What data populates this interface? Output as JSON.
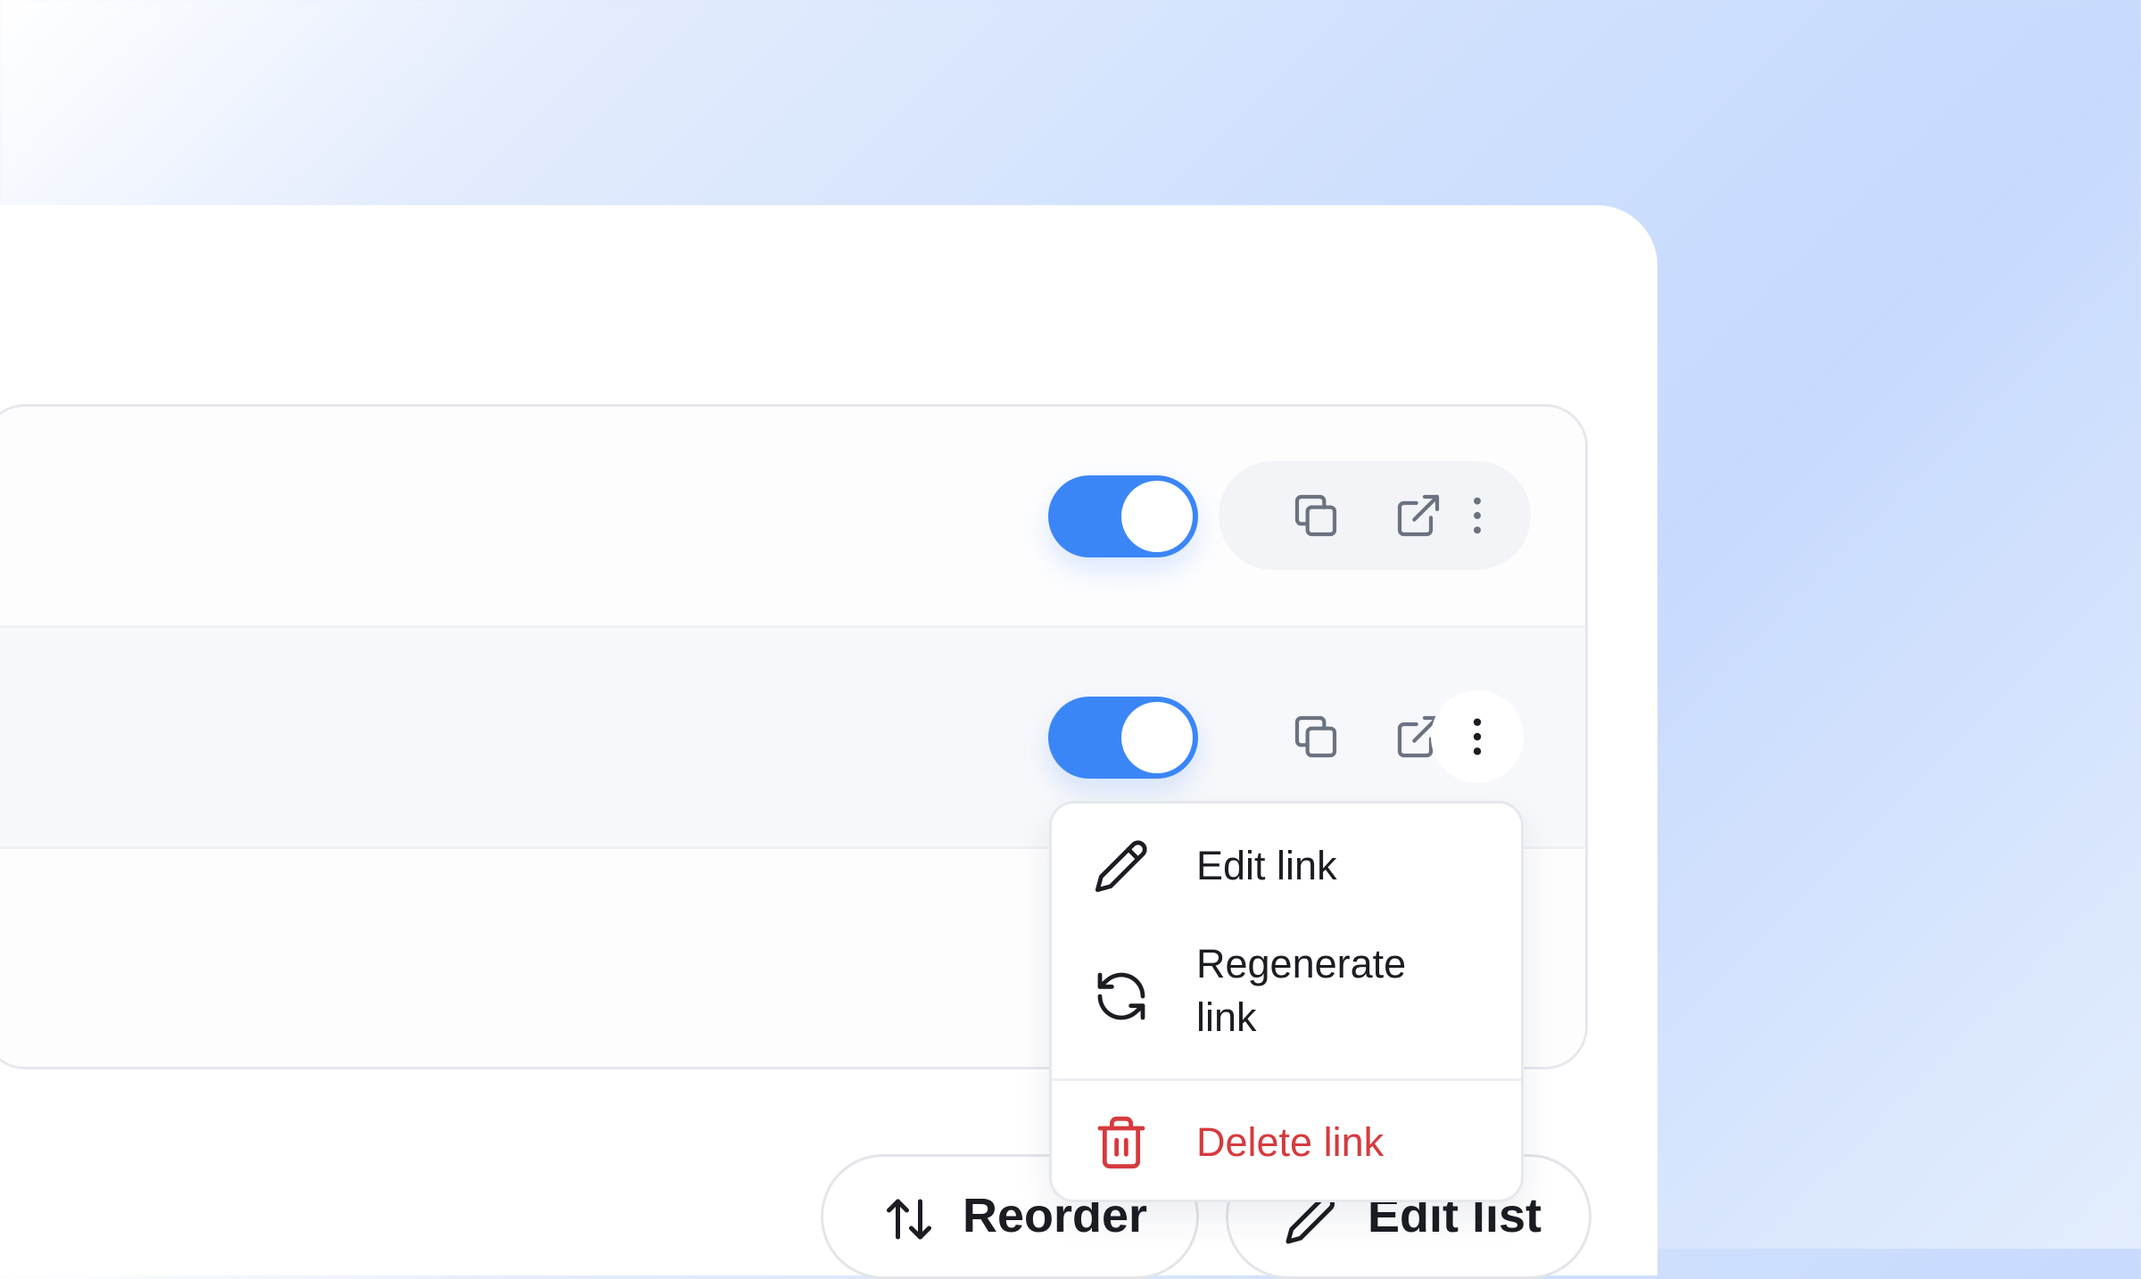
{
  "rows": [
    {
      "enabled": true,
      "actions": {
        "copy_icon": "copy-icon",
        "open_icon": "external-link-icon",
        "more_icon": "more-vertical-icon"
      }
    },
    {
      "enabled": true,
      "actions": {
        "copy_icon": "copy-icon",
        "open_icon": "external-link-icon",
        "more_icon": "more-vertical-icon"
      },
      "menu_open": true
    }
  ],
  "context_menu": {
    "edit_label": "Edit link",
    "regenerate_label_line1": "Regenerate",
    "regenerate_label_line2": "link",
    "delete_label": "Delete link"
  },
  "footer": {
    "reorder_label": "Reorder",
    "edit_list_label": "Edit list"
  },
  "colors": {
    "accent": "#3b86f7",
    "danger": "#d63a3e",
    "text": "#1b1d22",
    "icon": "#6b7280"
  }
}
